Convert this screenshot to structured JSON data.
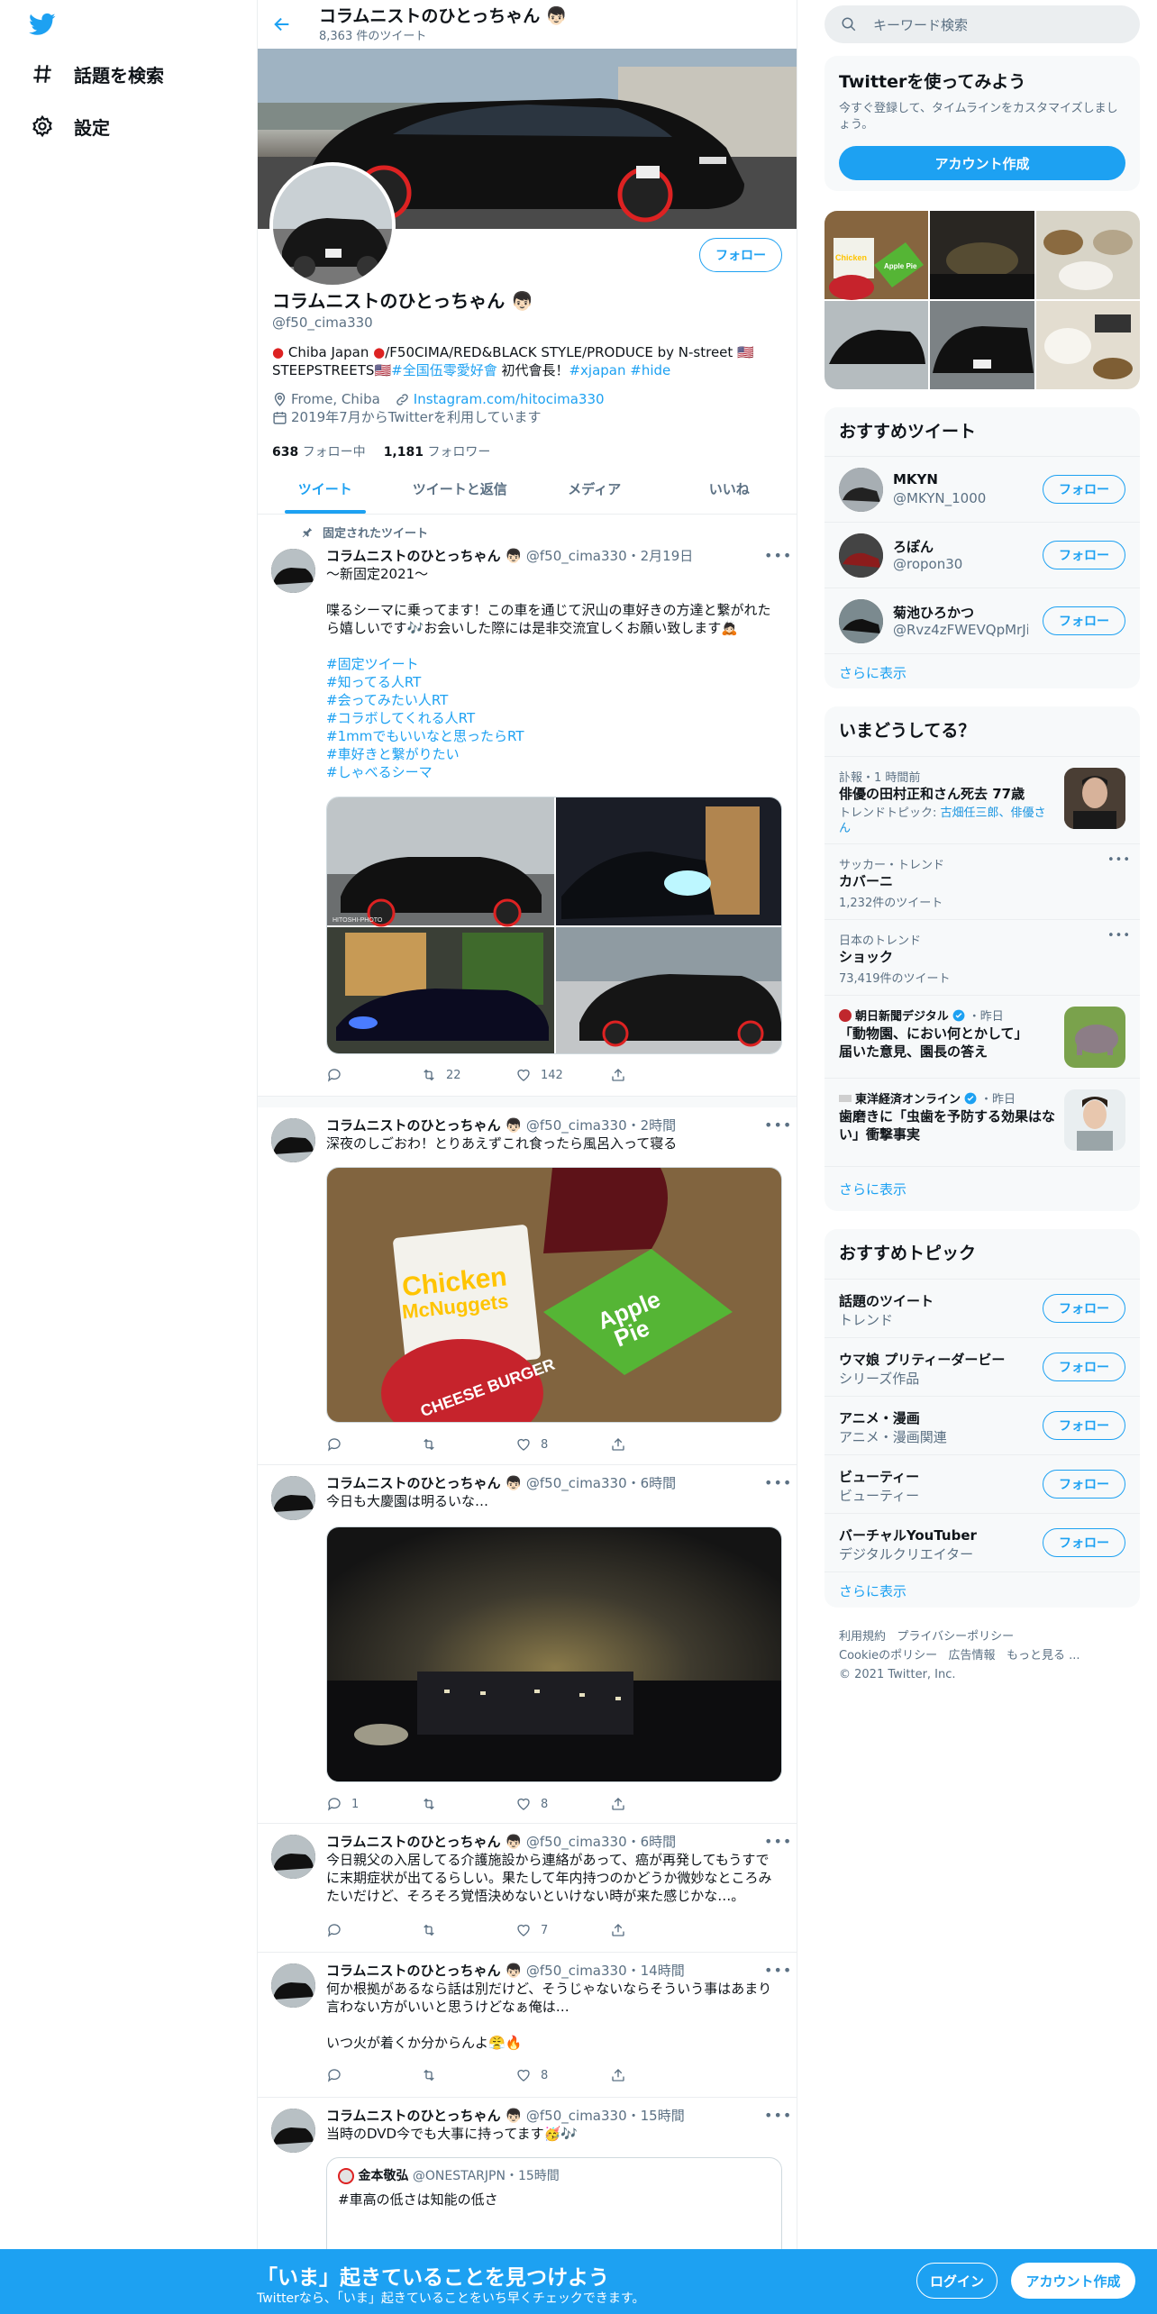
{
  "nav": {
    "items": [
      {
        "label": "話題を検索",
        "icon": "hashtag-icon"
      },
      {
        "label": "設定",
        "icon": "gear-icon"
      }
    ]
  },
  "header": {
    "name": "コラムニストのひとっちゃん",
    "tweet_count": "8,363 件のツイート"
  },
  "profile": {
    "follow_label": "フォロー",
    "name": "コラムニストのひとっちゃん",
    "handle": "@f50_cima330",
    "bio_plain_1": "Chiba Japan",
    "bio_plain_2": "/F50CIMA/RED&BLACK STYLE/PRODUCE by N-street",
    "bio_plain_3": "STEEPSTREETS",
    "bio_link_1": "#全国伍零愛好會",
    "bio_plain_4": " 初代會長！",
    "bio_link_2": "#xjapan",
    "bio_link_3": "#hide",
    "location": "Frome, Chiba",
    "website": "Instagram.com/hitocima330",
    "joined": "2019年7月からTwitterを利用しています",
    "following_count": "638",
    "following_label": "フォロー中",
    "followers_count": "1,181",
    "followers_label": "フォロワー"
  },
  "tabs": [
    "ツイート",
    "ツイートと返信",
    "メディア",
    "いいね"
  ],
  "pinned_label": "固定されたツイート",
  "tweets": [
    {
      "name": "コラムニストのひとっちゃん",
      "handle": "@f50_cima330",
      "time": "2月19日",
      "line1": "〜新固定2021〜",
      "line2": "喋るシーマに乗ってます！この車を通じて沢山の車好きの方達と繋がれた",
      "line3": "ら嬉しいです🎶お会いした際には是非交流宜しくお願い致します🙇🏻",
      "tags": [
        "#固定ツイート",
        "#知ってる人RT",
        "#会ってみたい人RT",
        "#コラボしてくれる人RT",
        "#1mmでもいいなと思ったらRT",
        "#車好きと繋がりたい",
        "#しゃべるシーマ"
      ],
      "photo_credit": "HITOSHI-PHOTO",
      "replies": "",
      "retweets": "22",
      "likes": "142"
    },
    {
      "name": "コラムニストのひとっちゃん",
      "handle": "@f50_cima330",
      "time": "2時間",
      "line1": "深夜のしごおわ！とりあえずこれ食ったら風呂入って寝る",
      "box1": "Chicken",
      "box2": "McNuggets",
      "pie1": "Apple",
      "pie2": "Pie",
      "burger": "CHEESE BURGER",
      "replies": "",
      "retweets": "",
      "likes": "8"
    },
    {
      "name": "コラムニストのひとっちゃん",
      "handle": "@f50_cima330",
      "time": "6時間",
      "line1": "今日も大慶園は明るいな…",
      "replies": "1",
      "retweets": "",
      "likes": "8"
    },
    {
      "name": "コラムニストのひとっちゃん",
      "handle": "@f50_cima330",
      "time": "6時間",
      "line1": "今日親父の入居してる介護施設から連絡があって、癌が再発してもうすで",
      "line2": "に末期症状が出てるらしい。果たして年内持つのかどうか微妙なところみ",
      "line3": "たいだけど、そろそろ覚悟決めないといけない時が来た感じかな…。",
      "replies": "",
      "retweets": "",
      "likes": "7"
    },
    {
      "name": "コラムニストのひとっちゃん",
      "handle": "@f50_cima330",
      "time": "14時間",
      "line1": "何か根拠があるなら話は別だけど、そうじゃないならそういう事はあまり",
      "line2": "言わない方がいいと思うけどなぁ俺は…",
      "line3": "いつ火が着くか分からんよ😤🔥",
      "replies": "",
      "retweets": "",
      "likes": "8"
    },
    {
      "name": "コラムニストのひとっちゃん",
      "handle": "@f50_cima330",
      "time": "15時間",
      "line1": "当時のDVD今でも大事に持ってます🥳🎶",
      "quote_name": "金本敬弘",
      "quote_handle": "@ONESTARJPN",
      "quote_time": "15時間",
      "quote_text": "#車高の低さは知能の低さ"
    }
  ],
  "search": {
    "placeholder": "キーワード検索"
  },
  "signup": {
    "title": "Twitterを使ってみよう",
    "desc1": "今すぐ登録して、タイムラインをカスタマイズしまし",
    "desc2": "ょう。",
    "button": "アカウント作成"
  },
  "photo_grid_labels": {
    "chicken": "Chicken",
    "pie": "Apple Pie"
  },
  "who_to_follow": {
    "title": "おすすめツイート",
    "users": [
      {
        "name": "MKYN",
        "handle": "@MKYN_1000",
        "follow": "フォロー"
      },
      {
        "name": "ろぽん",
        "handle": "@ropon30",
        "follow": "フォロー"
      },
      {
        "name": "菊池ひろかつ",
        "handle": "@Rvz4zFWEVQpMrJi",
        "follow": "フォロー"
      }
    ],
    "more": "さらに表示"
  },
  "trends": {
    "title": "いまどうしてる？",
    "items": [
      {
        "meta": "訃報・1 時間前",
        "title": "俳優の田村正和さん死去 77歳",
        "topic_label": "トレンドトピック: ",
        "topic_links": "古畑任三郎、俳優さ",
        "topic_links2": "ん"
      },
      {
        "meta": "サッカー・トレンド",
        "title": "カバーニ",
        "count": "1,232件のツイート"
      },
      {
        "meta": "日本のトレンド",
        "title": "ショック",
        "count": "73,419件のツイート"
      },
      {
        "source": "朝日新聞デジタル",
        "time": "・昨日",
        "title1": "「動物園、におい何とかして」",
        "title2": "届いた意見、園長の答え"
      },
      {
        "source": "東洋経済オンライン",
        "time": "・昨日",
        "title1": "歯磨きに「虫歯を予防する効果はな",
        "title2": "い」衝撃事実"
      }
    ],
    "more": "さらに表示"
  },
  "topics": {
    "title": "おすすめトピック",
    "items": [
      {
        "name": "話題のツイート",
        "sub": "トレンド",
        "follow": "フォロー"
      },
      {
        "name": "ウマ娘 プリティーダービー",
        "sub": "シリーズ作品",
        "follow": "フォロー"
      },
      {
        "name": "アニメ・漫画",
        "sub": "アニメ・漫画関連",
        "follow": "フォロー"
      },
      {
        "name": "ビューティー",
        "sub": "ビューティー",
        "follow": "フォロー"
      },
      {
        "name": "バーチャルYouTuber",
        "sub": "デジタルクリエイター",
        "follow": "フォロー"
      }
    ],
    "more": "さらに表示"
  },
  "footer": {
    "terms": "利用規約",
    "privacy": "プライバシーポリシー",
    "cookie": "Cookieのポリシー",
    "ads": "広告情報",
    "more": "もっと見る ...",
    "copyright": "© 2021 Twitter, Inc."
  },
  "bottom_bar": {
    "title": "「いま」起きていることを見つけよう",
    "subtitle": "Twitterなら、「いま」起きていることをいち早くチェックできます。",
    "login": "ログイン",
    "signup": "アカウント作成"
  }
}
